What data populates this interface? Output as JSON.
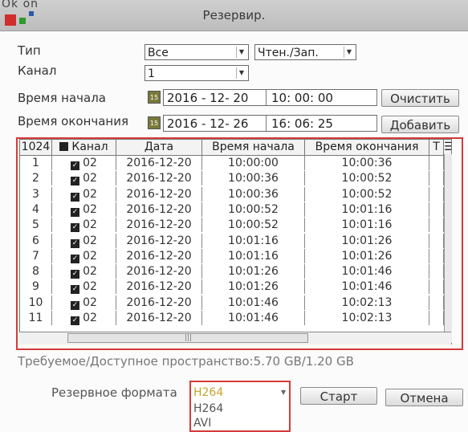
{
  "brand": {
    "text": "Ok on"
  },
  "window": {
    "title": "Резервир."
  },
  "filters": {
    "type_label": "Тип",
    "type_value": "Все",
    "mode_value": "Чтен./Зап.",
    "channel_label": "Канал",
    "channel_value": "1",
    "start_label": "Время начала",
    "start_date": "2016 - 12- 20",
    "start_time": "10: 00: 00",
    "end_label": "Время окончания",
    "end_date": "2016 - 12- 26",
    "end_time": "16: 06: 25",
    "calendar_icon_text": "15",
    "clear_button": "Очистить",
    "add_button": "Добавить"
  },
  "table": {
    "columns": [
      "1024",
      "Канал",
      "Дата",
      "Время начала",
      "Время окончания",
      "T"
    ],
    "rows": [
      {
        "num": "1",
        "channel": "02",
        "date": "2016-12-20",
        "start": "10:00:00",
        "end": "10:00:36"
      },
      {
        "num": "2",
        "channel": "02",
        "date": "2016-12-20",
        "start": "10:00:36",
        "end": "10:00:52"
      },
      {
        "num": "3",
        "channel": "02",
        "date": "2016-12-20",
        "start": "10:00:36",
        "end": "10:00:52"
      },
      {
        "num": "4",
        "channel": "02",
        "date": "2016-12-20",
        "start": "10:00:52",
        "end": "10:01:16"
      },
      {
        "num": "5",
        "channel": "02",
        "date": "2016-12-20",
        "start": "10:00:52",
        "end": "10:01:16"
      },
      {
        "num": "6",
        "channel": "02",
        "date": "2016-12-20",
        "start": "10:01:16",
        "end": "10:01:26"
      },
      {
        "num": "7",
        "channel": "02",
        "date": "2016-12-20",
        "start": "10:01:16",
        "end": "10:01:26"
      },
      {
        "num": "8",
        "channel": "02",
        "date": "2016-12-20",
        "start": "10:01:26",
        "end": "10:01:46"
      },
      {
        "num": "9",
        "channel": "02",
        "date": "2016-12-20",
        "start": "10:01:26",
        "end": "10:01:46"
      },
      {
        "num": "10",
        "channel": "02",
        "date": "2016-12-20",
        "start": "10:01:46",
        "end": "10:02:13"
      },
      {
        "num": "11",
        "channel": "02",
        "date": "2016-12-20",
        "start": "10:01:46",
        "end": "10:02:13"
      }
    ]
  },
  "space": {
    "text": "Требуемое/Доступное пространство:5.70 GB/1.20 GB"
  },
  "format": {
    "label": "Резервное формата",
    "selected": "H264",
    "options": [
      "H264",
      "AVI"
    ]
  },
  "actions": {
    "start": "Старт",
    "cancel": "Отмена"
  },
  "colors": {
    "highlight_border": "#d63a3a",
    "selected_format": "#c8a22a"
  }
}
